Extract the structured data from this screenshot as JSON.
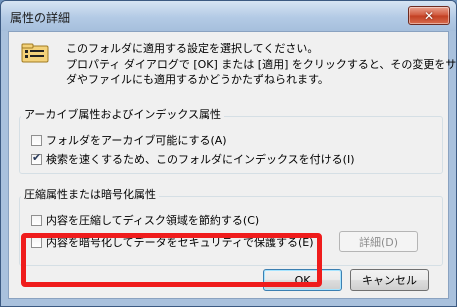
{
  "window": {
    "title": "属性の詳細"
  },
  "description": {
    "line1": "このフォルダに適用する設定を選択してください。",
    "line2": "プロパティ ダイアログで [OK] または [適用] をクリックすると、その変更をサブフォル",
    "line3": "ダやファイルにも適用するかどうかたずねられます。"
  },
  "archive_group": {
    "label": "アーカイブ属性およびインデックス属性",
    "checkboxes": [
      {
        "label": "フォルダをアーカイブ可能にする(A)",
        "checked": false
      },
      {
        "label": "検索を速くするため、このフォルダにインデックスを付ける(I)",
        "checked": true
      }
    ]
  },
  "compress_group": {
    "label": "圧縮属性または暗号化属性",
    "checkboxes": [
      {
        "label": "内容を圧縮してディスク領域を節約する(C)",
        "checked": false
      },
      {
        "label": "内容を暗号化してデータをセキュリティで保護する(E)",
        "checked": false
      }
    ],
    "details_label": "詳細(D)"
  },
  "buttons": {
    "ok": "OK",
    "cancel": "キャンセル"
  },
  "icons": {
    "close": "close-icon",
    "info": "folder-properties-icon",
    "check": "check-icon"
  },
  "colors": {
    "highlight": "#ef1c1c",
    "close_button": "#c94a2f"
  }
}
